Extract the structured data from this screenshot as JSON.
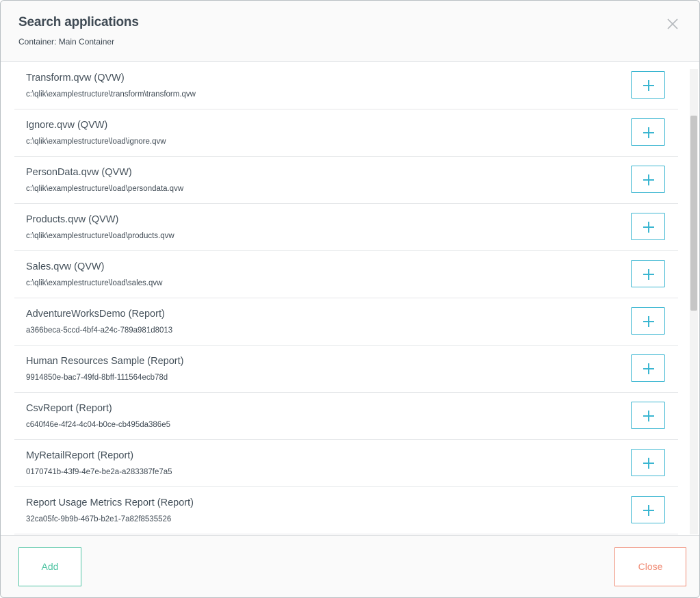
{
  "dialog": {
    "title": "Search applications",
    "subtitle": "Container: Main Container"
  },
  "applications": [
    {
      "name": "Transform.qvw (QVW)",
      "path": "c:\\qlik\\examplestructure\\transform\\transform.qvw"
    },
    {
      "name": "Ignore.qvw (QVW)",
      "path": "c:\\qlik\\examplestructure\\load\\ignore.qvw"
    },
    {
      "name": "PersonData.qvw (QVW)",
      "path": "c:\\qlik\\examplestructure\\load\\persondata.qvw"
    },
    {
      "name": "Products.qvw (QVW)",
      "path": "c:\\qlik\\examplestructure\\load\\products.qvw"
    },
    {
      "name": "Sales.qvw (QVW)",
      "path": "c:\\qlik\\examplestructure\\load\\sales.qvw"
    },
    {
      "name": "AdventureWorksDemo (Report)",
      "path": "a366beca-5ccd-4bf4-a24c-789a981d8013"
    },
    {
      "name": "Human Resources Sample (Report)",
      "path": "9914850e-bac7-49fd-8bff-111564ecb78d"
    },
    {
      "name": "CsvReport (Report)",
      "path": "c640f46e-4f24-4c04-b0ce-cb495da386e5"
    },
    {
      "name": "MyRetailReport (Report)",
      "path": "0170741b-43f9-4e7e-be2a-a283387fe7a5"
    },
    {
      "name": "Report Usage Metrics Report (Report)",
      "path": "32ca05fc-9b9b-467b-b2e1-7a82f8535526"
    }
  ],
  "footer": {
    "add_label": "Add",
    "close_label": "Close"
  },
  "colors": {
    "title": "#3f4a54",
    "plus_button": "#3bb6d1",
    "add_button": "#4fc4a3",
    "close_button": "#f08a73"
  },
  "icons": {
    "close": "close-x-icon",
    "add_row": "plus-icon"
  }
}
